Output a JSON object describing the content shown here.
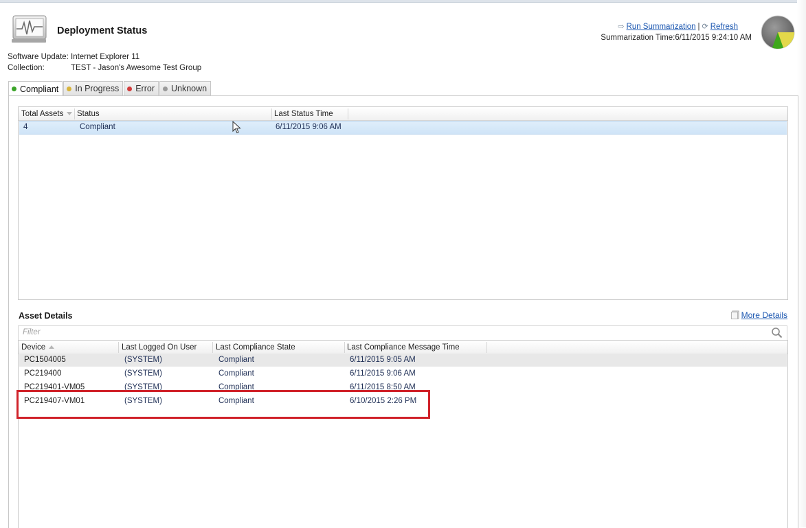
{
  "header": {
    "title": "Deployment Status",
    "icon": "heartbeat-monitor-icon",
    "software_update_label": "Software Update:",
    "software_update_value": "Internet Explorer 11",
    "collection_label": "Collection:",
    "collection_value": "TEST - Jason's Awesome Test Group",
    "run_summarization": "Run Summarization",
    "separator": "|",
    "refresh": "Refresh",
    "summarization_time_label": "Summarization Time:",
    "summarization_time_value": "6/11/2015 9:24:10 AM",
    "pie_colors": {
      "gray": "#6f6f6f",
      "green": "#3ea71a",
      "yellow": "#e3d84a"
    }
  },
  "tabs": [
    {
      "label": "Compliant",
      "color": "#3aa428",
      "active": true
    },
    {
      "label": "In Progress",
      "color": "#d8b43a",
      "active": false
    },
    {
      "label": "Error",
      "color": "#d23b3b",
      "active": false
    },
    {
      "label": "Unknown",
      "color": "#9a9a9a",
      "active": false
    }
  ],
  "summary_grid": {
    "columns": [
      "Total Assets",
      "Status",
      "Last Status Time"
    ],
    "rows": [
      {
        "total_assets": "4",
        "status": "Compliant",
        "last_status_time": "6/11/2015 9:06 AM"
      }
    ]
  },
  "asset_details": {
    "title": "Asset Details",
    "more_details": "More Details",
    "filter_placeholder": "Filter",
    "columns": [
      "Device",
      "Last Logged On User",
      "Last Compliance State",
      "Last Compliance Message Time"
    ],
    "rows": [
      {
        "device": "PC1504005",
        "user": "(SYSTEM)",
        "state": "Compliant",
        "time": "6/11/2015 9:05 AM"
      },
      {
        "device": "PC219400",
        "user": "(SYSTEM)",
        "state": "Compliant",
        "time": "6/11/2015 9:06 AM"
      },
      {
        "device": "PC219401-VM05",
        "user": "(SYSTEM)",
        "state": "Compliant",
        "time": "6/11/2015 8:50 AM"
      },
      {
        "device": "PC219407-VM01",
        "user": "(SYSTEM)",
        "state": "Compliant",
        "time": "6/10/2015 2:26 PM"
      }
    ],
    "highlight_color": "#d0222a"
  }
}
